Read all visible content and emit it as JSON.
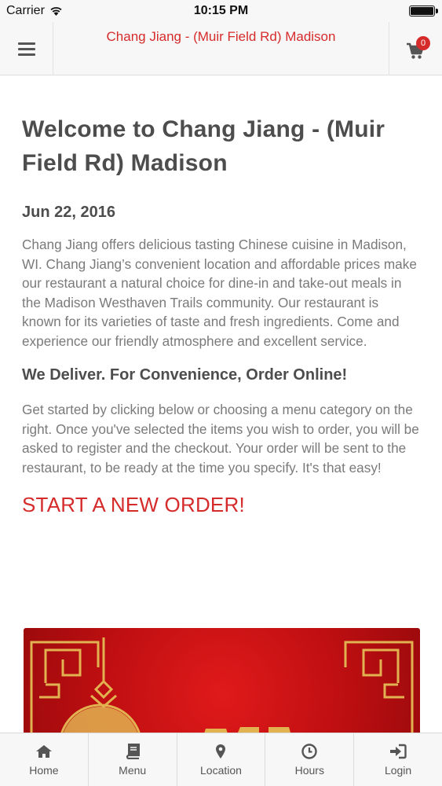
{
  "status_bar": {
    "carrier": "Carrier",
    "time": "10:15 PM"
  },
  "header": {
    "title": "Chang Jiang - (Muir Field Rd) Madison",
    "cart_count": "0"
  },
  "main": {
    "title": "Welcome to Chang Jiang - (Muir Field Rd) Madison",
    "date": "Jun 22, 2016",
    "intro": "Chang Jiang offers delicious tasting Chinese cuisine in Madison, WI. Chang Jiang’s convenient location and affordable prices make our restaurant a natural choice for dine-in and take-out meals in the Madison Westhaven Trails community. Our restaurant is known for its varieties of taste and fresh ingredients. Come and experience our friendly atmosphere and excellent service.",
    "subheading": "We Deliver. For Convenience, Order Online!",
    "instructions": "Get started by clicking below or choosing a menu category on the right. Once you've selected the items you wish to order, you will be asked to register and the checkout. Your order will be sent to the restaurant, to be ready at the time you specify. It's that easy!",
    "cta": "START A NEW ORDER!"
  },
  "tab_bar": {
    "tabs": [
      {
        "label": "Home",
        "icon": "home-icon"
      },
      {
        "label": "Menu",
        "icon": "book-icon"
      },
      {
        "label": "Location",
        "icon": "map-pin-icon"
      },
      {
        "label": "Hours",
        "icon": "clock-icon"
      },
      {
        "label": "Login",
        "icon": "login-icon"
      }
    ]
  },
  "colors": {
    "accent": "#d62b2b",
    "banner_red": "#c00f12",
    "gold": "#e2b250"
  }
}
